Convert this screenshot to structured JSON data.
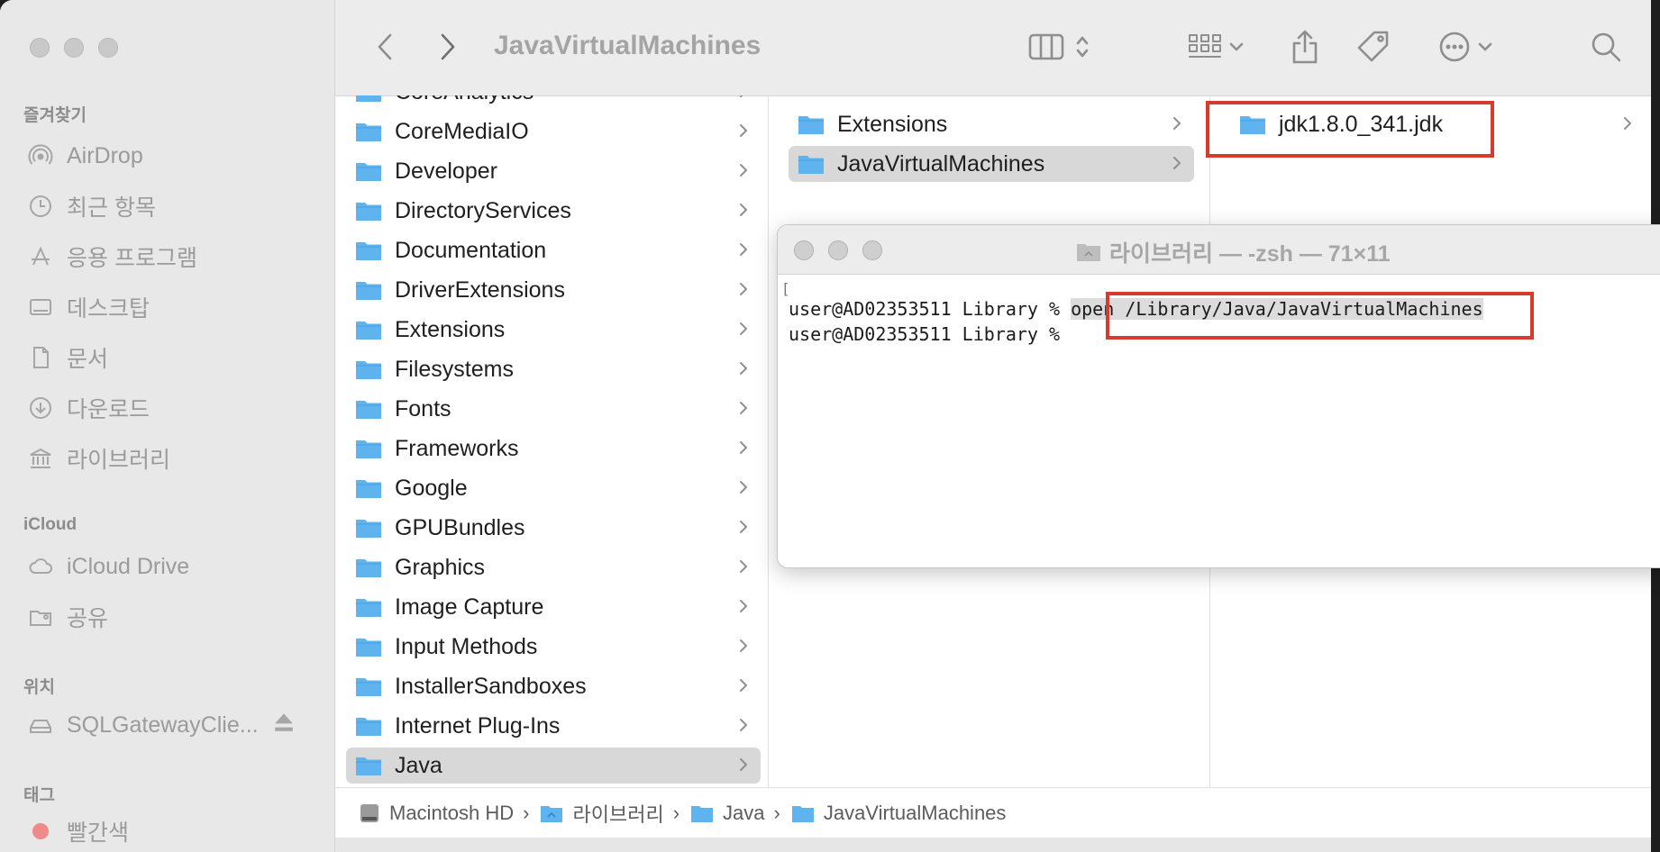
{
  "toolbar": {
    "title": "JavaVirtualMachines"
  },
  "sidebar": {
    "favorites_header": "즐겨찾기",
    "favorites": [
      "AirDrop",
      "최근 항목",
      "응용 프로그램",
      "데스크탑",
      "문서",
      "다운로드",
      "라이브러리"
    ],
    "icloud_header": "iCloud",
    "icloud": [
      "iCloud Drive",
      "공유"
    ],
    "locations_header": "위치",
    "locations": [
      "SQLGatewayClie..."
    ],
    "tags_header": "태그",
    "tags": [
      "빨간색"
    ]
  },
  "column1": {
    "items": [
      "CoreAnalytics",
      "CoreMediaIO",
      "Developer",
      "DirectoryServices",
      "Documentation",
      "DriverExtensions",
      "Extensions",
      "Filesystems",
      "Fonts",
      "Frameworks",
      "Google",
      "GPUBundles",
      "Graphics",
      "Image Capture",
      "Input Methods",
      "InstallerSandboxes",
      "Internet Plug-Ins",
      "Java"
    ],
    "selected": "Java"
  },
  "column2": {
    "items": [
      "Extensions",
      "JavaVirtualMachines"
    ],
    "selected": "JavaVirtualMachines"
  },
  "column3": {
    "items": [
      "jdk1.8.0_341.jdk"
    ]
  },
  "terminal": {
    "title": "라이브러리 — -zsh — 71×11",
    "bracket": "[",
    "prompt": "user@AD02353511 Library %",
    "command": "open /Library/Java/JavaVirtualMachines"
  },
  "pathbar": [
    "Macintosh HD",
    "라이브러리",
    "Java",
    "JavaVirtualMachines"
  ],
  "colors": {
    "folder_blue": "#5fb4f0",
    "highlight_red": "#d63c2e",
    "tag_red": "#f08a8a"
  }
}
